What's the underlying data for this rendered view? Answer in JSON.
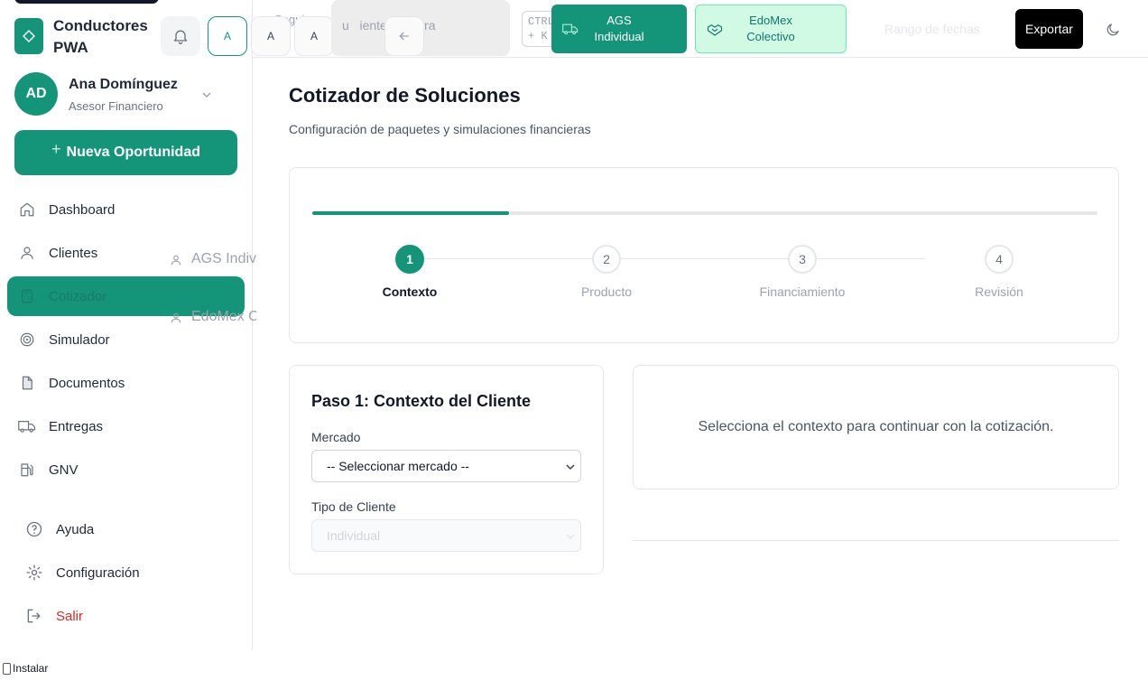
{
  "app": {
    "name": "Conductores PWA",
    "install_label": "Instalar"
  },
  "user": {
    "initials": "AD",
    "name": "Ana Domínguez",
    "role": "Asesor Financiero"
  },
  "sidebar": {
    "new_button": "Nueva Oportunidad",
    "items": [
      {
        "label": "Dashboard",
        "icon": "home-icon"
      },
      {
        "label": "Clientes",
        "icon": "user-icon"
      },
      {
        "label": "Cotizador",
        "icon": "calculator-icon",
        "active": true
      },
      {
        "label": "Simulador",
        "icon": "target-icon"
      },
      {
        "label": "Documentos",
        "icon": "document-icon"
      },
      {
        "label": "Entregas",
        "icon": "truck-icon"
      },
      {
        "label": "GNV",
        "icon": "fuel-icon"
      }
    ],
    "subitems": [
      {
        "label": "AGS Individual",
        "icon": "user-icon"
      },
      {
        "label": "EdoMex Colectivo",
        "icon": "user-icon"
      }
    ],
    "footer": [
      {
        "label": "Ayuda",
        "icon": "help-icon"
      },
      {
        "label": "Configuración",
        "icon": "gear-icon"
      },
      {
        "label": "Salir",
        "icon": "logout-icon"
      }
    ]
  },
  "header": {
    "font_buttons": [
      "A",
      "A",
      "A"
    ],
    "search_placeholder": "Buscar clientes, contratos...",
    "search_visible_fragment": "u   ientes, contra",
    "ghost_text": "Seguir",
    "shortcut": [
      "CTRL",
      "+ K"
    ],
    "markets": [
      {
        "line1": "AGS",
        "line2": "Individual",
        "icon": "truck-icon",
        "active": true
      },
      {
        "line1": "EdoMex",
        "line2": "Colectivo",
        "icon": "handshake-icon",
        "active": false
      }
    ],
    "date_range": "Rango de fechas",
    "export": "Exportar"
  },
  "main": {
    "title": "Cotizador de Soluciones",
    "subtitle": "Configuración de paquetes y simulaciones financieras",
    "progress": 0.25,
    "steps": [
      {
        "num": "1",
        "label": "Contexto",
        "active": true
      },
      {
        "num": "2",
        "label": "Producto",
        "active": false
      },
      {
        "num": "3",
        "label": "Financiamiento",
        "active": false
      },
      {
        "num": "4",
        "label": "Revisión",
        "active": false
      }
    ],
    "form": {
      "title": "Paso 1: Contexto del Cliente",
      "market_label": "Mercado",
      "market_value": "-- Seleccionar mercado --",
      "client_type_label": "Tipo de Cliente",
      "client_type_value": "Individual"
    },
    "info": "Selecciona el contexto para continuar con la cotización."
  },
  "colors": {
    "primary": "#14957a",
    "danger": "#dc2626",
    "light_accent": "#d1fae5"
  }
}
